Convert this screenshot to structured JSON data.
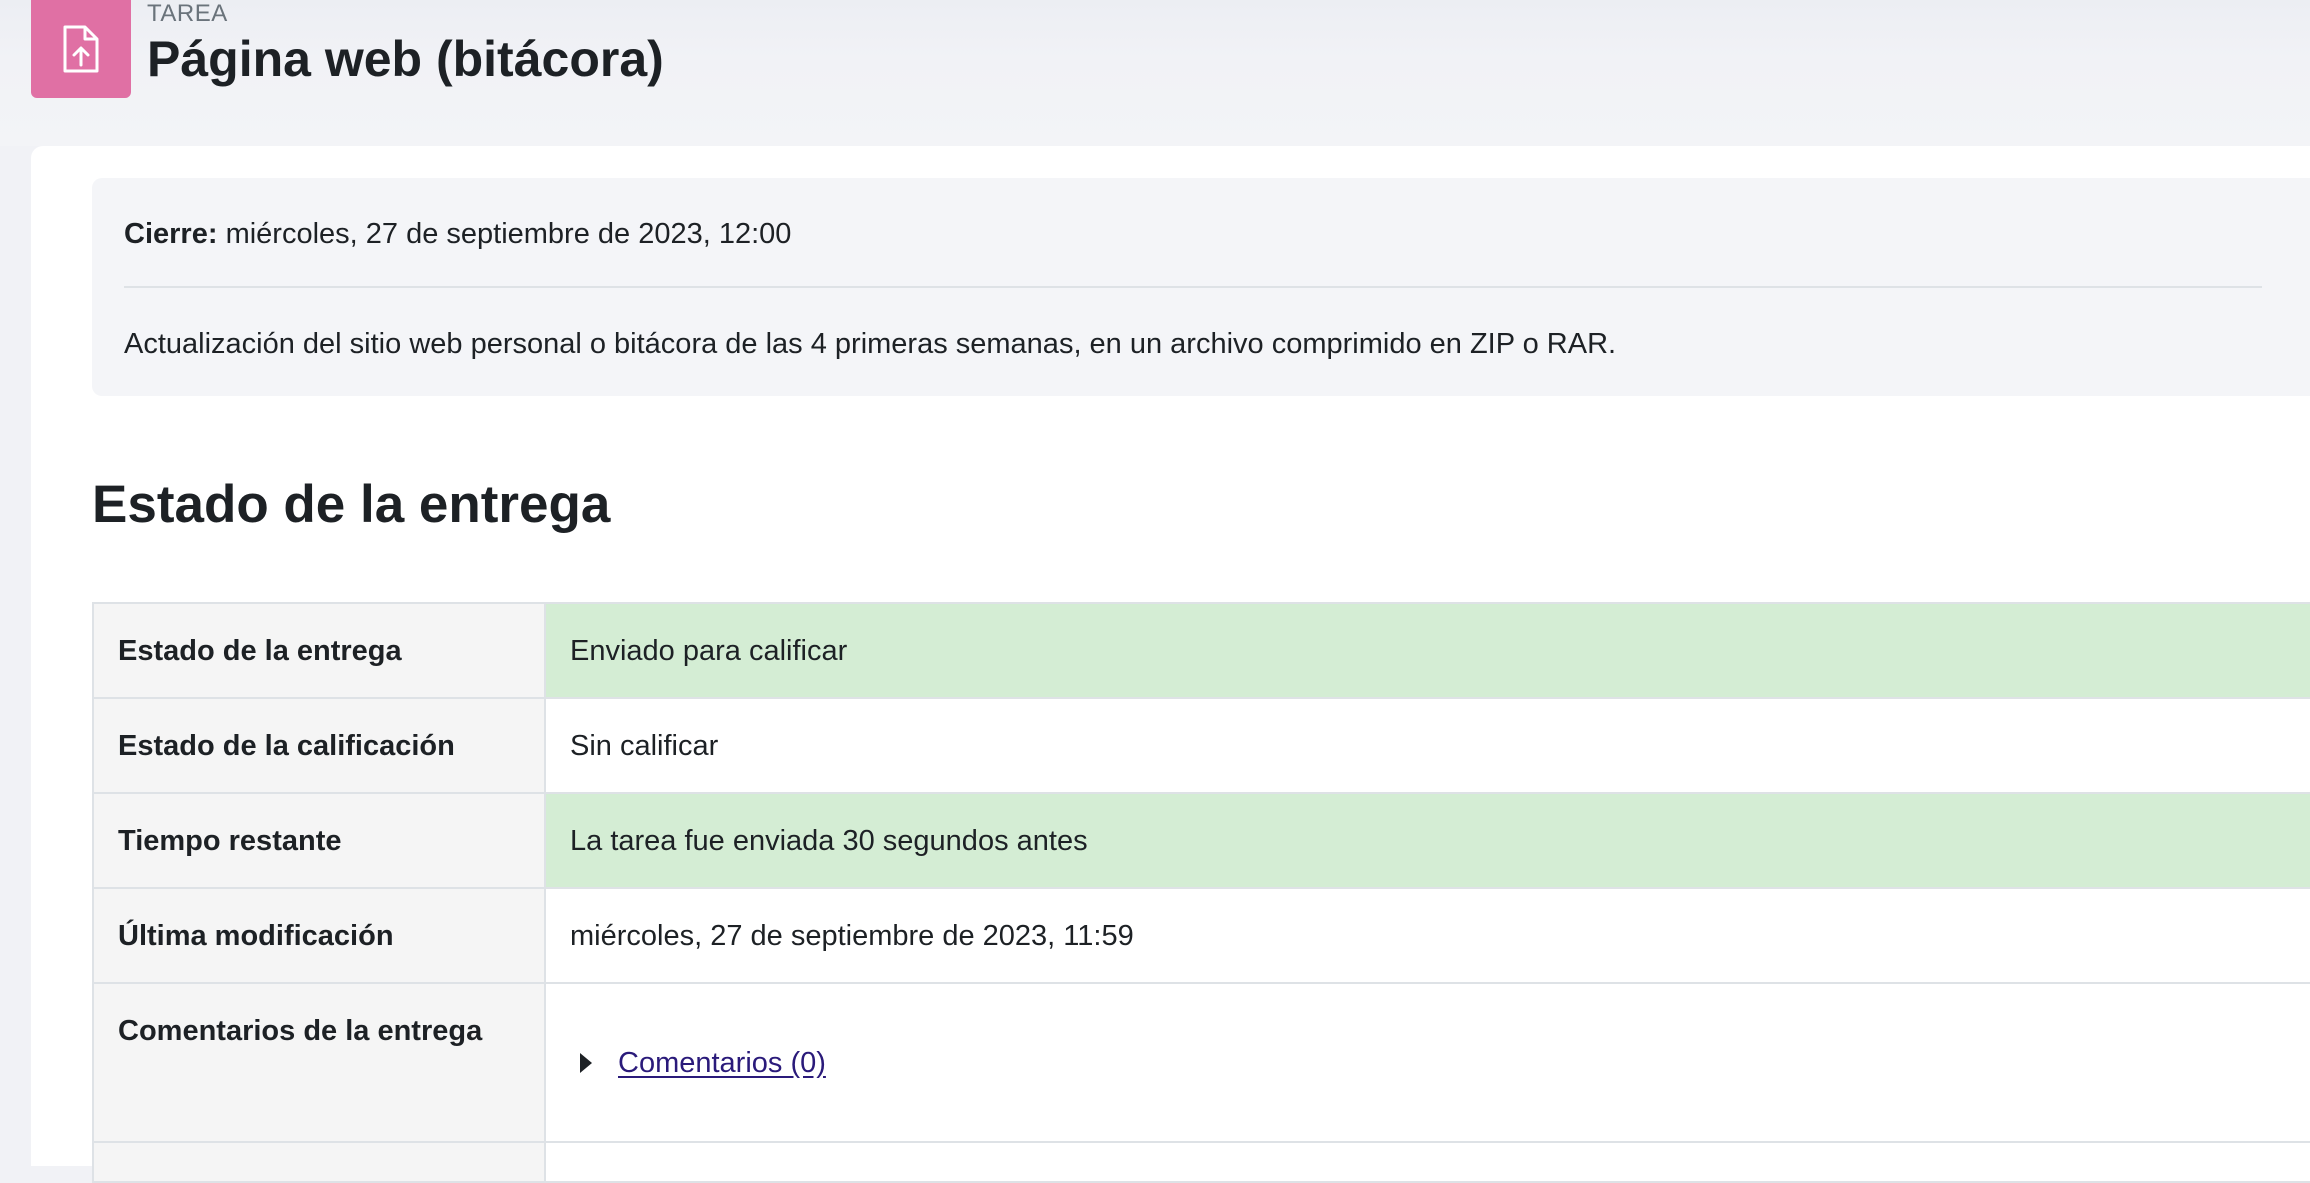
{
  "header": {
    "activity_type": "TAREA",
    "title": "Página web (bitácora)",
    "icon": "file-upload-icon",
    "icon_color": "#e070a4"
  },
  "info": {
    "due_label": "Cierre:",
    "due_value": "miércoles, 27 de septiembre de 2023, 12:00",
    "description": "Actualización del sitio web personal o bitácora de las 4 primeras semanas, en un archivo comprimido en ZIP o RAR."
  },
  "submission": {
    "heading": "Estado de la entrega",
    "rows": [
      {
        "label": "Estado de la entrega",
        "value": "Enviado para calificar"
      },
      {
        "label": "Estado de la calificación",
        "value": "Sin calificar"
      },
      {
        "label": "Tiempo restante",
        "value": "La tarea fue enviada 30 segundos antes"
      },
      {
        "label": "Última modificación",
        "value": "miércoles, 27 de septiembre de 2023, 11:59"
      },
      {
        "label": "Comentarios de la entrega",
        "value": "Comentarios (0)"
      }
    ]
  },
  "colors": {
    "success_bg": "#d4edd4",
    "link": "#2a1a7a"
  }
}
